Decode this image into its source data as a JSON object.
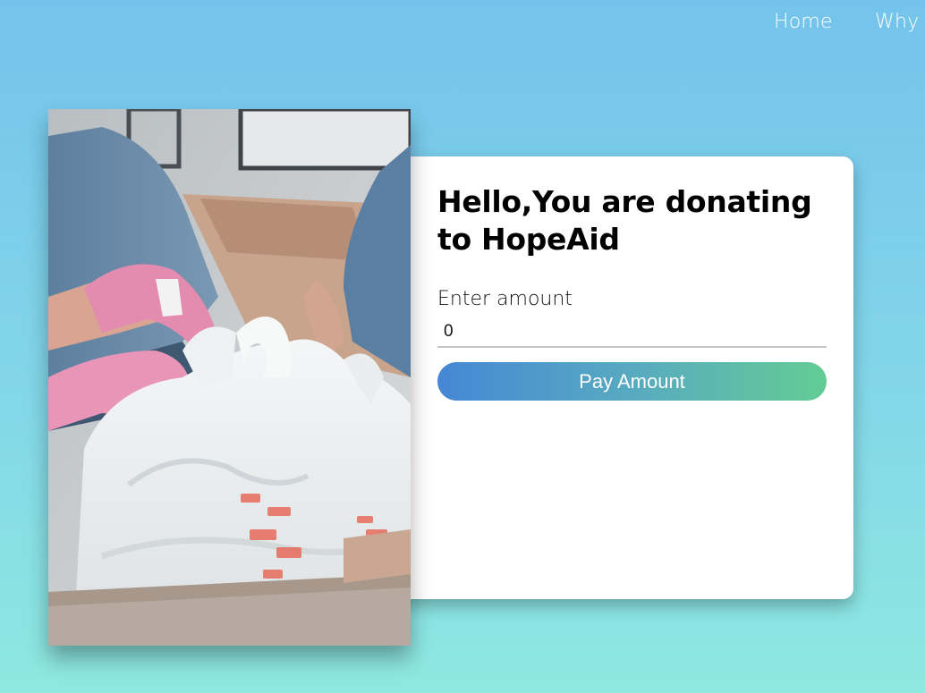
{
  "nav": {
    "items": [
      {
        "label": "Home"
      },
      {
        "label": "Why"
      }
    ]
  },
  "donation": {
    "title": "Hello,You are donating to HopeAid",
    "amount_label": "Enter amount",
    "amount_value": "0",
    "pay_label": "Pay Amount"
  },
  "photo": {
    "icon": "volunteers-packing-food-bags-image"
  },
  "colors": {
    "background_top": "#74c3ec",
    "background_bottom": "#8ee8e0",
    "button_gradient_start": "#4587d4",
    "button_gradient_end": "#63cc94"
  }
}
